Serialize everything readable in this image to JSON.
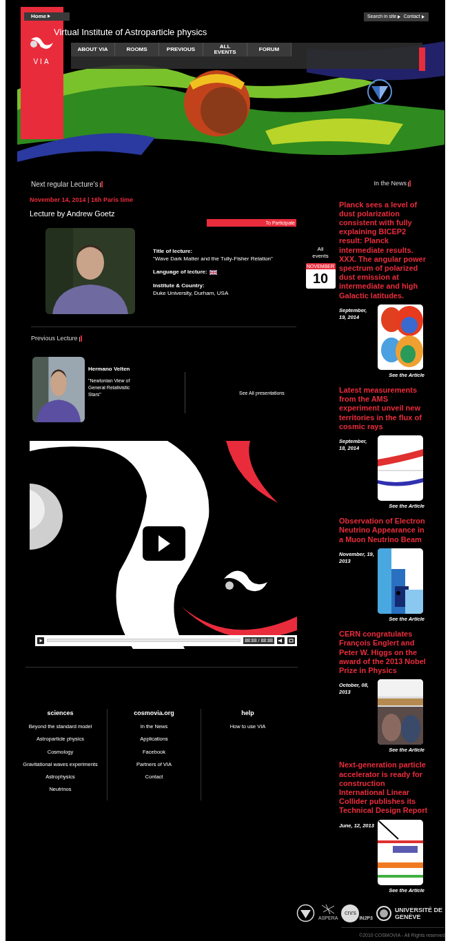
{
  "header": {
    "home": "Home",
    "search": "Search in site",
    "contact": "Contact",
    "logo_text": "VIA",
    "site_title": "Virtual Institute of Astroparticle physics",
    "menu": [
      {
        "label": "ABOUT VIA"
      },
      {
        "label": "ROOMS"
      },
      {
        "label": "PREVIOUS"
      },
      {
        "label": "ALL EVENTS"
      },
      {
        "label": "FORUM"
      }
    ]
  },
  "next_lecture": {
    "heading": "Next regular Lecture's",
    "date": "November 14, 2014 | 16h Paris time",
    "title": "Lecture by Andrew Goetz",
    "participate": "To Participate",
    "details": [
      {
        "kind": "text",
        "label": "Title of lecture:",
        "value": "\"Wave Dark Matter and the Tully-Fisher Relation\""
      },
      {
        "kind": "flag",
        "label": "Language of lecture:"
      },
      {
        "kind": "text",
        "label": "Institute & Country:",
        "value": "Duke University, Durham, USA"
      }
    ]
  },
  "events": {
    "label": "All events",
    "month": "NOVEMBER",
    "day": "10"
  },
  "previous_lecture": {
    "heading": "Previous Lecture",
    "speaker": "Hermano Velten",
    "talk": "\"Newtonian View of General Relativistic Stars\"",
    "see_all": "See All presentations"
  },
  "video": {
    "time": "88:88 / 88:88"
  },
  "news": {
    "heading": "In the News",
    "items": [
      {
        "headline": "Planck sees a level of dust polarization consistent with fully explaining BICEP2 result: Planck intermediate results. XXX. The angular power spectrum of polarized dust emission at intermediate and high Galactic latitudes.",
        "date": "September, 19, 2014",
        "link": "See the Article"
      },
      {
        "headline": "Latest measurements from the AMS experiment unveil new territories in the flux of cosmic rays",
        "date": "September, 18, 2014",
        "link": "See the Article"
      },
      {
        "headline": "Observation of Electron Neutrino Appearance in a Muon Neutrino Beam",
        "date": "November, 19, 2013",
        "link": "See the Article"
      },
      {
        "headline": "CERN congratulates François Englert and Peter W. Higgs on the award of the 2013 Nobel Prize in Physics",
        "date": "October, 08, 2013",
        "link": "See the Article"
      },
      {
        "headline": "Next-generation particle accelerator is ready for construction International Linear Collider publishes its Technical Design Report",
        "date": "June, 12, 2013",
        "link": "See the Article"
      }
    ]
  },
  "footer": {
    "columns": [
      {
        "title": "sciences",
        "links": [
          "Beyond the standard model",
          "Astroparticle physics",
          "Cosmology",
          "Gravitational waves experiments",
          "Astrophysics",
          "Neutrinos"
        ]
      },
      {
        "title": "cosmovia.org",
        "links": [
          "In the News",
          "Applications",
          "Facebook",
          "Partners of VIA",
          "Contact"
        ]
      },
      {
        "title": "help",
        "links": [
          "How to use VIA"
        ]
      }
    ]
  },
  "partners": {
    "aspera": "ASPERA",
    "cnrs": "cnrs",
    "in2p3": "IN2P3",
    "unige": "UNIVERSITÉ DE GENÈVE"
  },
  "copyright": "©2010 COSMOVIA - All Rights reserved"
}
